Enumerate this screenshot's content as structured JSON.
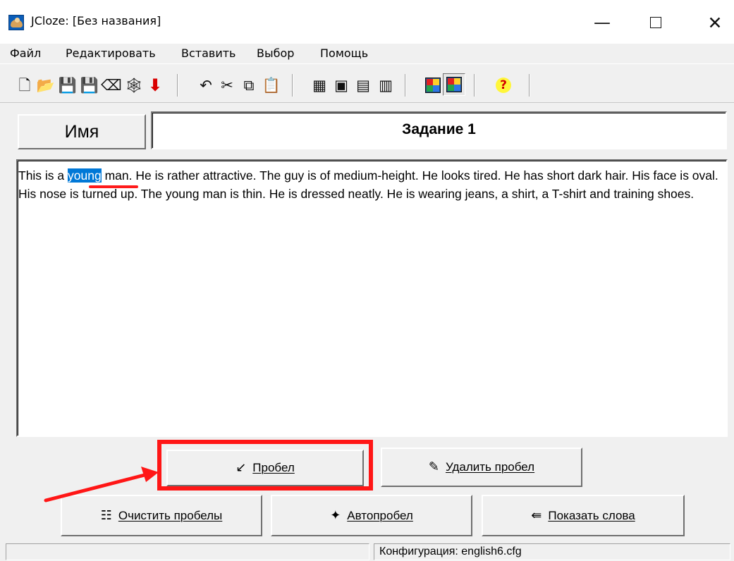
{
  "window": {
    "title": "JCloze: [Без названия]",
    "minimize": "—",
    "close": "✕"
  },
  "menu": [
    "Файл",
    "Редактировать",
    "Вставить",
    "Выбор",
    "Помощь"
  ],
  "toolbar": {
    "icons": [
      "new-document-icon",
      "open-folder-icon",
      "save-icon",
      "save-as-icon",
      "eraser-icon",
      "web-export-icon",
      "down-arrow-icon",
      "undo-icon",
      "cut-icon",
      "copy-icon",
      "paste-icon",
      "cloze-web-icon",
      "export-icon",
      "options-icon",
      "config-icon",
      "colour-config-icon",
      "pressed-colour-icon",
      "help-icon"
    ],
    "glyphs": {
      "new": "🗋",
      "open": "📂",
      "save": "💾",
      "saveas": "💾",
      "eraser": "⌫",
      "web": "🕸",
      "down": "⬇",
      "undo": "↶",
      "cut": "✂",
      "copy": "⧉",
      "paste": "📋",
      "webpage": "▦",
      "export": "▣",
      "options": "▤",
      "config": "▥",
      "help": "?"
    }
  },
  "editor": {
    "name_button": "Имя",
    "task_title": "Задание 1",
    "text_before": "This is a ",
    "selected_word": "young",
    "text_after": " man. He is rather attractive. The guy is of medium-height. He looks tired. He has short dark hair. His face is oval. His nose is turned up. The young man is thin. He is dressed neatly. He is wearing jeans, a shirt, a T-shirt and training shoes."
  },
  "buttons": {
    "gap": {
      "label": "Пробел",
      "icon": "↙"
    },
    "remove_gap": {
      "label": "Удалить пробел",
      "icon": "✎"
    },
    "clear_gaps": {
      "label": "Очистить пробелы",
      "icon": "☷"
    },
    "auto_gap": {
      "label": "Автопробел",
      "icon": "✦"
    },
    "show_words": {
      "label": "Показать слова",
      "icon": "⇚"
    }
  },
  "annotations": {
    "highlight_color": "#ff1616",
    "arrow_color": "#ff1616",
    "selection_color": "#0078d7"
  },
  "status": {
    "configuration": "Конфигурация: english6.cfg"
  }
}
